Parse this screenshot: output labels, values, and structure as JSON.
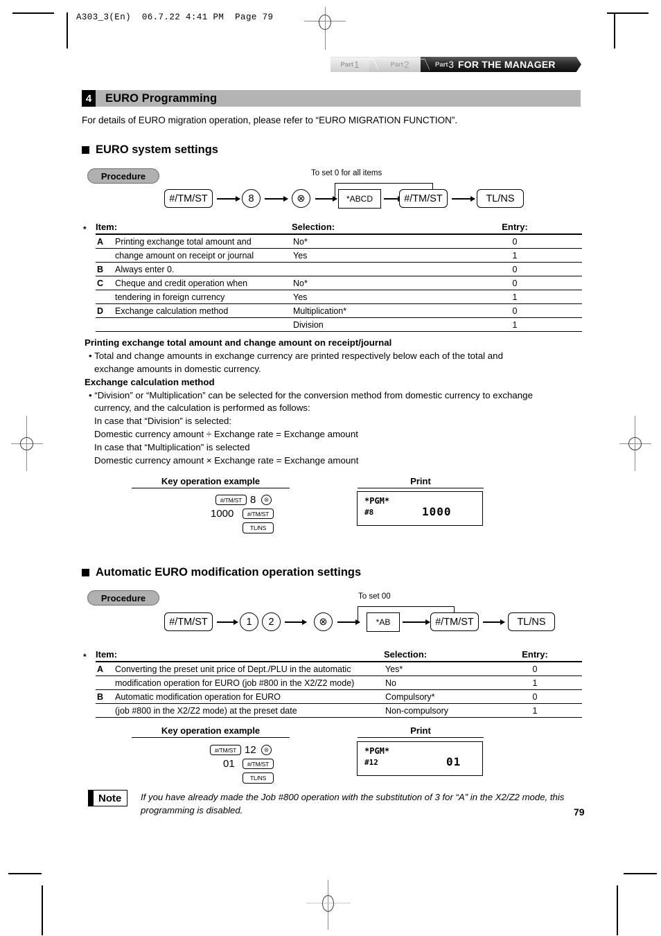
{
  "file_header": "A303_3(En)  06.7.22 4:41 PM  Page 79",
  "banner": {
    "tab1_word": "Part",
    "tab1_num": "1",
    "tab2_word": "Part",
    "tab2_num": "2",
    "tab3_word": "Part",
    "tab3_num": "3",
    "tab3_title": "FOR THE MANAGER"
  },
  "section": {
    "number": "4",
    "title": "EURO Programming",
    "intro": "For details of EURO migration operation, please refer to “EURO MIGRATION FUNCTION”."
  },
  "sub1": {
    "heading": "EURO system settings",
    "procedure_label": "Procedure",
    "skip_label": "To set  0  for all items",
    "flow": [
      {
        "type": "key",
        "label": "#/TM/ST"
      },
      {
        "type": "circle",
        "label": "8"
      },
      {
        "type": "circle",
        "label": "⊗"
      },
      {
        "type": "entry",
        "label": "*ABCD"
      },
      {
        "type": "key",
        "label": "#/TM/ST"
      },
      {
        "type": "key",
        "label": "TL/NS"
      }
    ],
    "table": {
      "star": "*",
      "headers": [
        "Item:",
        "Selection:",
        "Entry:"
      ],
      "rows": [
        {
          "code": "A",
          "desc": "Printing exchange total amount and",
          "selection": "No*",
          "entry": "0"
        },
        {
          "code": "",
          "desc": "change amount on receipt or journal",
          "selection": "Yes",
          "entry": "1"
        },
        {
          "code": "B",
          "desc": "Always enter 0.",
          "selection": "",
          "entry": "0"
        },
        {
          "code": "C",
          "desc": "Cheque and credit operation when",
          "selection": "No*",
          "entry": "0"
        },
        {
          "code": "",
          "desc": "tendering in foreign currency",
          "selection": "Yes",
          "entry": "1"
        },
        {
          "code": "D",
          "desc": "Exchange calculation method",
          "selection": "Multiplication*",
          "entry": "0"
        },
        {
          "code": "",
          "desc": "",
          "selection": "Division",
          "entry": "1"
        }
      ]
    },
    "explain": {
      "h1": "Printing exchange total amount and change amount on receipt/journal",
      "p1a": "• Total and change amounts in exchange currency are printed respectively below each of the total and",
      "p1b": "exchange amounts in domestic currency.",
      "h2": "Exchange calculation method",
      "p2a": "• “Division” or “Multiplication” can be selected for the conversion method from domestic currency to exchange",
      "p2b": "currency, and the calculation is performed as follows:",
      "p2c": "In case that “Division” is selected:",
      "p2d": "Domestic currency amount ÷ Exchange rate = Exchange amount",
      "p2e": "In case that “Multiplication” is selected",
      "p2f": "Domestic currency amount × Exchange rate = Exchange amount"
    },
    "example": {
      "keyop_header": "Key operation example",
      "print_header": "Print",
      "keys": {
        "k1": "#/TM/ST",
        "k2": "8",
        "k3": "⊗",
        "k4": "1000",
        "k5": "#/TM/ST",
        "k6": "TL/NS"
      },
      "print": {
        "line1": "*PGM*",
        "line2_left": "#8",
        "line2_right": "1000"
      }
    }
  },
  "sub2": {
    "heading": "Automatic EURO modification operation settings",
    "procedure_label": "Procedure",
    "skip_label": "To set  00",
    "flow": [
      {
        "type": "key",
        "label": "#/TM/ST"
      },
      {
        "type": "circle",
        "label": "1"
      },
      {
        "type": "circle",
        "label": "2"
      },
      {
        "type": "circle",
        "label": "⊗"
      },
      {
        "type": "entry",
        "label": "*AB"
      },
      {
        "type": "key",
        "label": "#/TM/ST"
      },
      {
        "type": "key",
        "label": "TL/NS"
      }
    ],
    "table": {
      "star": "*",
      "headers": [
        "Item:",
        "Selection:",
        "Entry:"
      ],
      "rows": [
        {
          "code": "A",
          "desc": "Converting the preset unit price of Dept./PLU in the automatic",
          "selection": "Yes*",
          "entry": "0"
        },
        {
          "code": "",
          "desc": "modification operation for EURO (job #800 in the X2/Z2 mode)",
          "selection": "No",
          "entry": "1"
        },
        {
          "code": "B",
          "desc": "Automatic modification operation for EURO",
          "selection": "Compulsory*",
          "entry": "0"
        },
        {
          "code": "",
          "desc": "(job #800 in the X2/Z2 mode) at the preset date",
          "selection": "Non-compulsory",
          "entry": "1"
        }
      ]
    },
    "example": {
      "keyop_header": "Key operation example",
      "print_header": "Print",
      "keys": {
        "k1": "#/TM/ST",
        "k2": "12",
        "k3": "⊗",
        "k4": "01",
        "k5": "#/TM/ST",
        "k6": "TL/NS"
      },
      "print": {
        "line1": "*PGM*",
        "line2_left": "#12",
        "line2_right": "01"
      }
    }
  },
  "note": {
    "label": "Note",
    "line1": "If you have already made the Job #800 operation with the substitution of 3 for “A” in the X2/Z2",
    "line2": "mode, this programming is disabled."
  },
  "page_number": "79"
}
